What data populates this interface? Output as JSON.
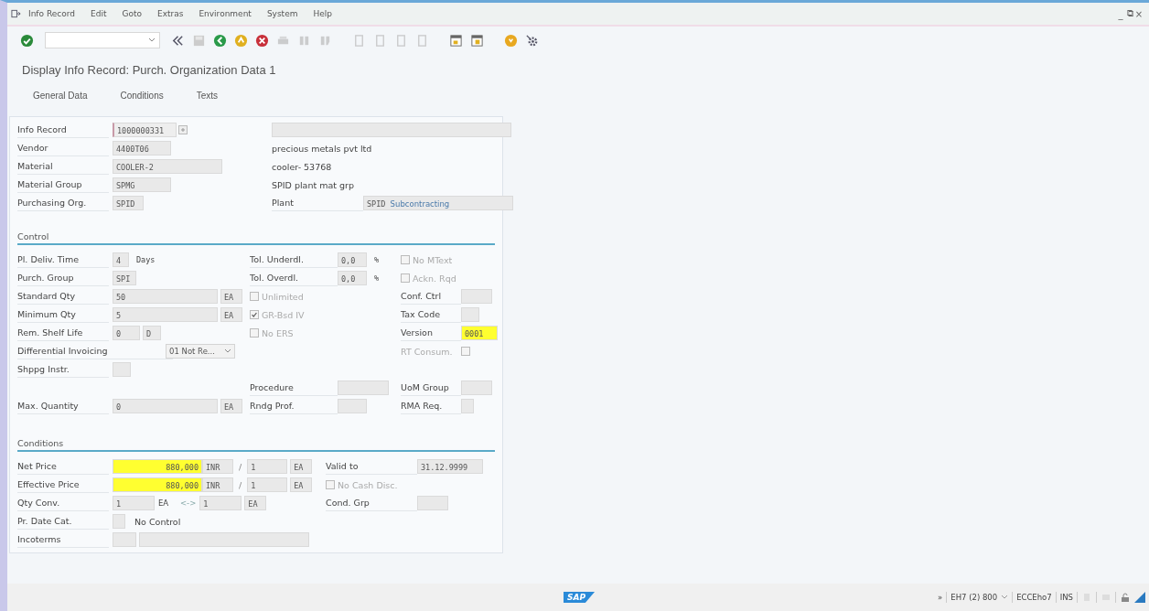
{
  "menu": [
    "Info Record",
    "Edit",
    "Goto",
    "Extras",
    "Environment",
    "System",
    "Help"
  ],
  "window_controls": [
    "_",
    "⧉",
    "×"
  ],
  "title": "Display Info Record: Purch. Organization Data 1",
  "tabs": [
    {
      "label": "General Data",
      "selected": false
    },
    {
      "label": "Conditions",
      "selected": false
    },
    {
      "label": "Texts",
      "selected": false
    }
  ],
  "header": {
    "info_record": {
      "label": "Info Record",
      "value": "1000000331"
    },
    "vendor": {
      "label": "Vendor",
      "value": "4400T06",
      "description": "precious metals pvt ltd"
    },
    "material": {
      "label": "Material",
      "value": "COOLER-2",
      "description": "cooler- 53768"
    },
    "material_group": {
      "label": "Material Group",
      "value": "SPMG",
      "description": "SPID plant mat grp"
    },
    "purchasing_org": {
      "label": "Purchasing Org.",
      "value": "SPID"
    },
    "plant": {
      "label": "Plant",
      "value": "SPID",
      "description": "Subcontracting"
    }
  },
  "control": {
    "title": "Control",
    "pl_deliv_time": {
      "label": "Pl. Deliv. Time",
      "value": "4",
      "unit": "Days"
    },
    "purch_group": {
      "label": "Purch. Group",
      "value": "SPI"
    },
    "standard_qty": {
      "label": "Standard Qty",
      "value": "50",
      "unit": "EA"
    },
    "minimum_qty": {
      "label": "Minimum Qty",
      "value": "5",
      "unit": "EA"
    },
    "rem_shelf_life": {
      "label": "Rem. Shelf Life",
      "value": "0",
      "unit": "D"
    },
    "differential_invoicing": {
      "label": "Differential Invoicing",
      "value": "01 Not Re..."
    },
    "shppg_instr": {
      "label": "Shppg Instr."
    },
    "max_quantity": {
      "label": "Max. Quantity",
      "value": "0",
      "unit": "EA"
    },
    "tol_underdl": {
      "label": "Tol. Underdl.",
      "value": "0,0",
      "unit": "%"
    },
    "tol_overdl": {
      "label": "Tol. Overdl.",
      "value": "0,0",
      "unit": "%"
    },
    "procedure": {
      "label": "Procedure"
    },
    "rndg_prof": {
      "label": "Rndg Prof."
    },
    "checkboxes": [
      {
        "label": "No MText",
        "checked": false
      },
      {
        "label": "Ackn. Rqd",
        "checked": false
      },
      {
        "label": "Unlimited",
        "checked": false
      },
      {
        "label": "GR-Bsd IV",
        "checked": true
      },
      {
        "label": "No ERS",
        "checked": false
      }
    ],
    "conf_ctrl": {
      "label": "Conf. Ctrl"
    },
    "tax_code": {
      "label": "Tax Code"
    },
    "version": {
      "label": "Version",
      "value": "0001",
      "highlighted": true
    },
    "rt_consum": {
      "label": "RT Consum.",
      "checked": false
    },
    "uom_group": {
      "label": "UoM Group"
    },
    "rma_req": {
      "label": "RMA Req."
    }
  },
  "conditions": {
    "title": "Conditions",
    "net_price": {
      "label": "Net Price",
      "value": "880,000",
      "highlighted": true,
      "currency": "INR",
      "per": "/",
      "quantity": "1",
      "unit": "EA"
    },
    "effective_price": {
      "label": "Effective Price",
      "value": "880,000",
      "highlighted": true,
      "currency": "INR",
      "per": "/",
      "quantity": "1",
      "unit": "EA"
    },
    "qty_conv": {
      "label": "Qty Conv.",
      "value": "1",
      "unit": "EA",
      "arrow": "<->",
      "value_2": "1",
      "unit_2": "EA"
    },
    "pr_date_cat": {
      "label": "Pr. Date Cat.",
      "description": "No Control"
    },
    "incoterms": {
      "label": "Incoterms"
    },
    "valid_to": {
      "label": "Valid to",
      "value": "31.12.9999"
    },
    "no_cash_disc": {
      "label": "No Cash Disc.",
      "checked": false
    },
    "cond_grp": {
      "label": "Cond. Grp"
    }
  },
  "status_bar": {
    "logo": "SAP",
    "expand": "»",
    "system": "EH7 (2) 800",
    "server": "ECCEho7",
    "mode": "INS"
  }
}
